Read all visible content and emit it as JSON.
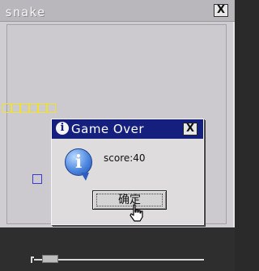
{
  "window": {
    "title": "snake",
    "close_label": "X"
  },
  "game": {
    "snake_segments": 6,
    "board_color": "#ccc9cf",
    "snake_color": "#f0e12a",
    "food_color": "#3b3bd0"
  },
  "dialog": {
    "title": "Game Over",
    "close_label": "X",
    "title_icon_glyph": "i",
    "info_icon_glyph": "i",
    "message": "score:40",
    "ok_label": "确定",
    "title_bar_color": "#15207e"
  },
  "icons": {
    "info": "info-icon",
    "cursor": "hand-pointer-icon"
  }
}
